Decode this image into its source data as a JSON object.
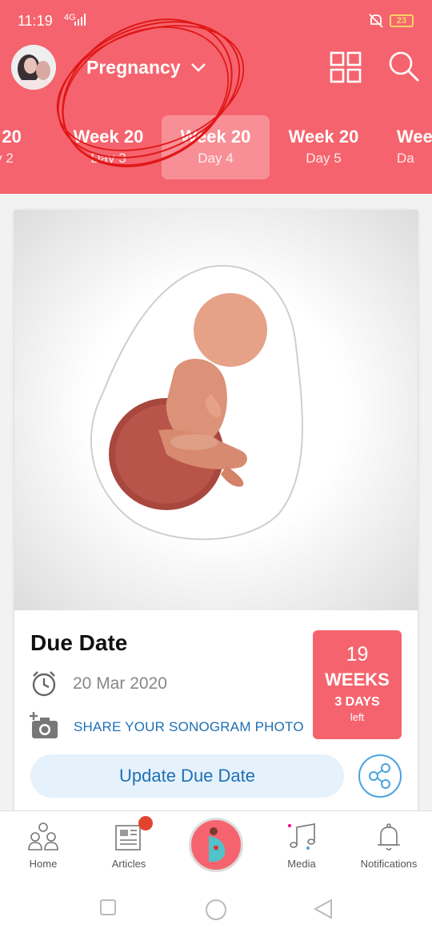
{
  "status_bar": {
    "time": "11:19",
    "network": "4G",
    "battery": "23"
  },
  "header": {
    "title": "Pregnancy"
  },
  "days": [
    {
      "week": "k 20",
      "day": "y 2"
    },
    {
      "week": "Week 20",
      "day": "Day 3"
    },
    {
      "week": "Week 20",
      "day": "Day 4"
    },
    {
      "week": "Week 20",
      "day": "Day 5"
    },
    {
      "week": "Wee",
      "day": "Da"
    }
  ],
  "card": {
    "title": "Due Date",
    "due_date": "20 Mar 2020",
    "share_photo": "SHARE YOUR SONOGRAM PHOTO",
    "weeks_badge": {
      "number": "19",
      "weeks": "WEEKS",
      "days": "3 DAYS",
      "left": "left"
    },
    "update_button": "Update Due Date"
  },
  "nav": {
    "home": "Home",
    "articles": "Articles",
    "media": "Media",
    "notifications": "Notifications"
  },
  "colors": {
    "brand": "#f5646e",
    "link": "#1f6fb5",
    "badge": "#e2452f"
  },
  "icons": [
    "avatar",
    "chevron-down-icon",
    "grid-icon",
    "search-icon",
    "clock-icon",
    "camera-add-icon",
    "share-icon",
    "home-icon",
    "articles-icon",
    "pregnancy-icon",
    "media-icon",
    "bell-icon"
  ]
}
